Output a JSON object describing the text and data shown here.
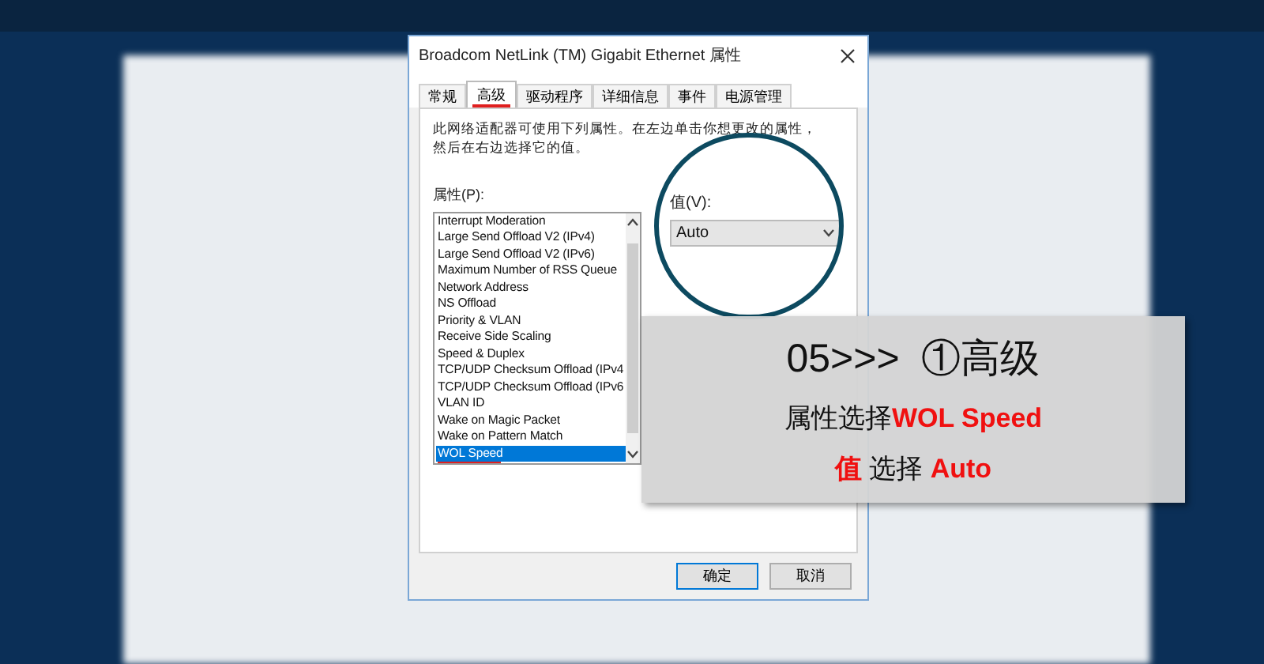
{
  "dialog": {
    "title": "Broadcom NetLink (TM) Gigabit Ethernet 属性",
    "tabs": [
      {
        "label": "常规",
        "selected": false
      },
      {
        "label": "高级",
        "selected": true
      },
      {
        "label": "驱动程序",
        "selected": false
      },
      {
        "label": "详细信息",
        "selected": false
      },
      {
        "label": "事件",
        "selected": false
      },
      {
        "label": "电源管理",
        "selected": false
      }
    ],
    "description": "此网络适配器可使用下列属性。在左边单击你想更改的属性，然后在右边选择它的值。",
    "property_label": "属性(P):",
    "properties": [
      {
        "label": "Interrupt Moderation",
        "selected": false
      },
      {
        "label": "Large Send Offload V2 (IPv4)",
        "selected": false
      },
      {
        "label": "Large Send Offload V2 (IPv6)",
        "selected": false
      },
      {
        "label": "Maximum Number of RSS Queue",
        "selected": false
      },
      {
        "label": "Network Address",
        "selected": false
      },
      {
        "label": "NS Offload",
        "selected": false
      },
      {
        "label": "Priority & VLAN",
        "selected": false
      },
      {
        "label": "Receive Side Scaling",
        "selected": false
      },
      {
        "label": "Speed & Duplex",
        "selected": false
      },
      {
        "label": "TCP/UDP Checksum Offload (IPv4",
        "selected": false
      },
      {
        "label": "TCP/UDP Checksum Offload (IPv6",
        "selected": false
      },
      {
        "label": "VLAN ID",
        "selected": false
      },
      {
        "label": "Wake on Magic Packet",
        "selected": false
      },
      {
        "label": "Wake on Pattern Match",
        "selected": false
      },
      {
        "label": "WOL Speed",
        "selected": true
      }
    ],
    "value_label": "值(V):",
    "value": "Auto",
    "buttons": [
      {
        "label": "确定",
        "default": true
      },
      {
        "label": "取消",
        "default": false
      }
    ]
  },
  "overlay": {
    "lines": [
      {
        "segments": [
          {
            "text": "05>>>  ①高级",
            "emphasis": false
          }
        ]
      },
      {
        "segments": [
          {
            "text": "属性选择",
            "emphasis": false
          },
          {
            "text": "WOL Speed",
            "emphasis": true
          }
        ]
      },
      {
        "segments": [
          {
            "text": "值",
            "emphasis": true
          },
          {
            "text": " 选择 ",
            "emphasis": false
          },
          {
            "text": "Auto",
            "emphasis": true
          }
        ]
      }
    ]
  }
}
